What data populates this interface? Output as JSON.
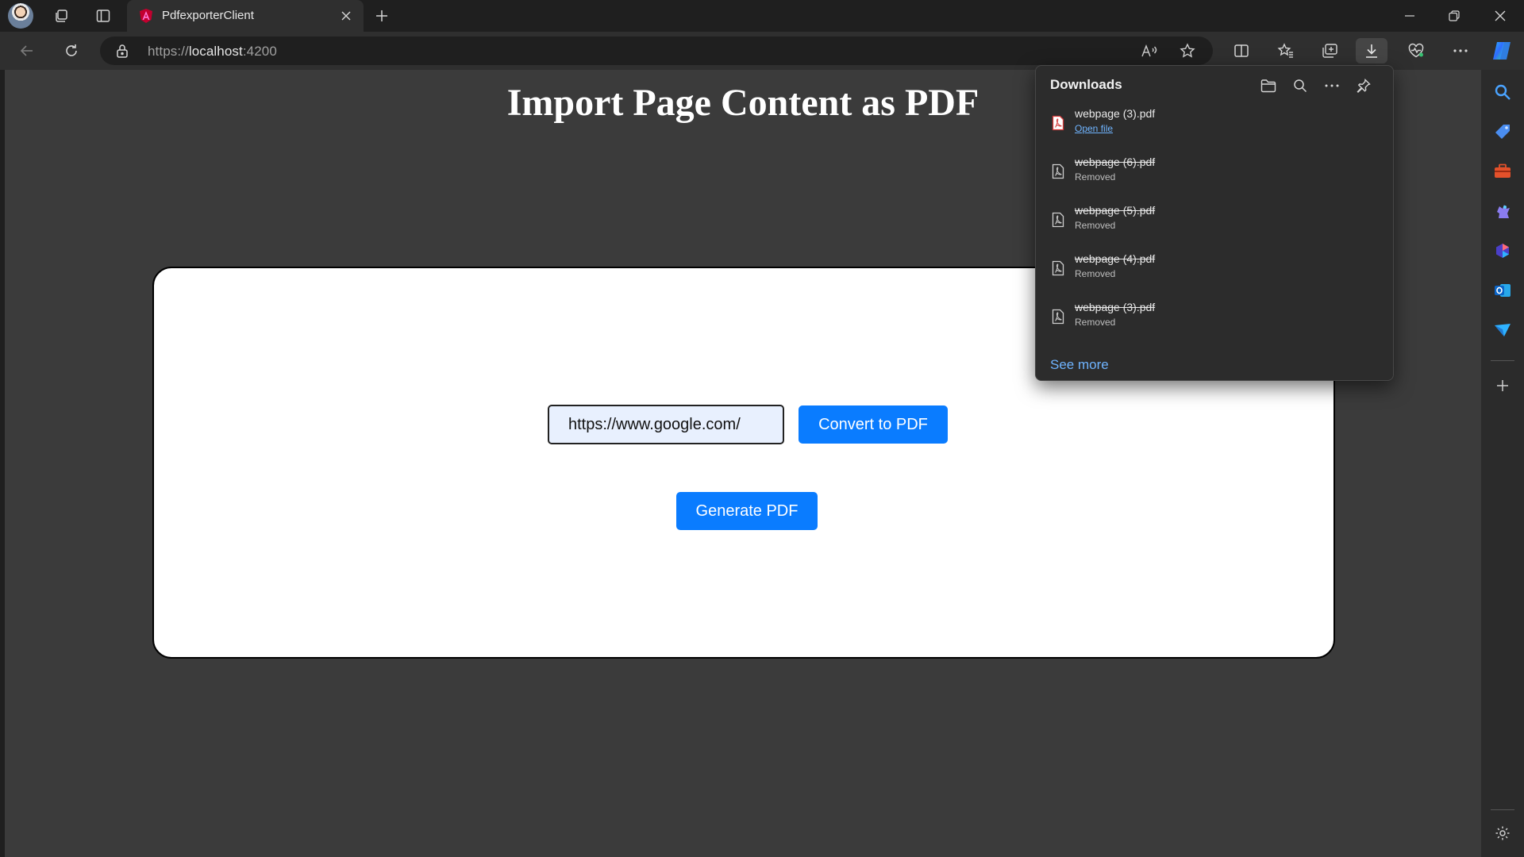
{
  "browser": {
    "tab": {
      "title": "PdfexporterClient"
    },
    "address": {
      "scheme": "https://",
      "host": "localhost",
      "port": ":4200"
    }
  },
  "page": {
    "title": "Import Page Content as PDF",
    "url_input_value": "https://www.google.com/",
    "convert_button": "Convert to PDF",
    "generate_button": "Generate PDF"
  },
  "downloads": {
    "title": "Downloads",
    "items": [
      {
        "name": "webpage (3).pdf",
        "status": "Open file",
        "removed": false
      },
      {
        "name": "webpage (6).pdf",
        "status": "Removed",
        "removed": true
      },
      {
        "name": "webpage (5).pdf",
        "status": "Removed",
        "removed": true
      },
      {
        "name": "webpage (4).pdf",
        "status": "Removed",
        "removed": true
      },
      {
        "name": "webpage (3).pdf",
        "status": "Removed",
        "removed": true
      }
    ],
    "see_more": "See more"
  },
  "colors": {
    "accent_button": "#0a7cff",
    "link": "#6fb4ff",
    "page_background": "#3b3b3b",
    "browser_chrome": "#1f1f1f"
  }
}
